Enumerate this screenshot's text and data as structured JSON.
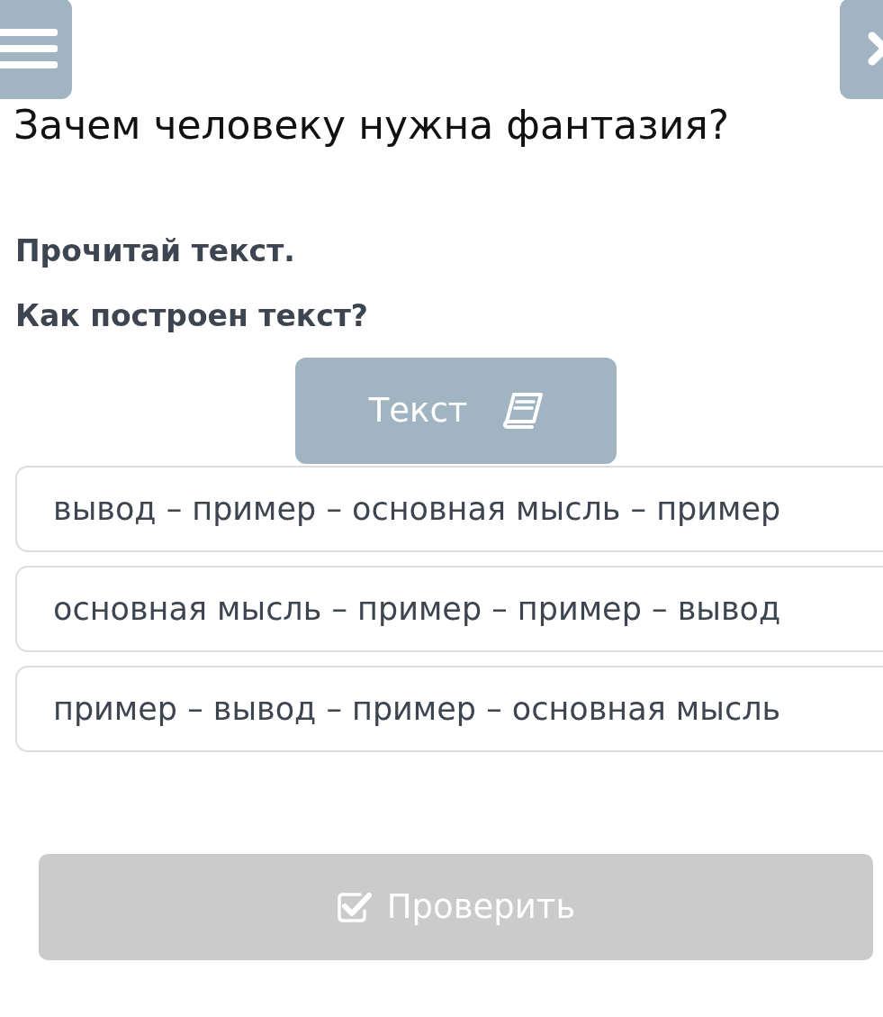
{
  "title": "Зачем человеку нужна фантазия?",
  "instructions": [
    "Прочитай текст.",
    "Как построен текст?"
  ],
  "text_button": {
    "label": "Текст"
  },
  "options": [
    {
      "label": "вывод – пример – основная мысль – пример",
      "selected": false
    },
    {
      "label": "основная мысль – пример – пример – вывод",
      "selected": false
    },
    {
      "label": "пример – вывод – пример – основная мысль",
      "selected": false
    }
  ],
  "check_button": {
    "label": "Проверить",
    "disabled": true
  }
}
